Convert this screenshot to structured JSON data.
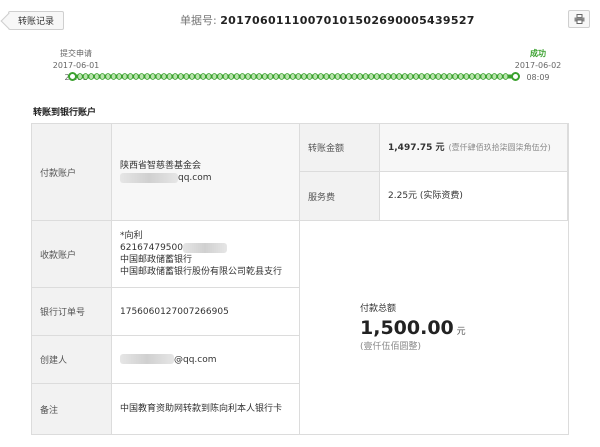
{
  "header": {
    "back_label": "转账记录",
    "order_label": "单据号:",
    "order_number": "20170601110070101502690005439527",
    "print_icon": "printer-icon"
  },
  "progress": {
    "start_label": "提交申请",
    "start_time": "2017-06-01 20:51",
    "end_label": "成功",
    "end_time": "2017-06-02 08:09",
    "color": "#3aa12e"
  },
  "section": {
    "title": "转账到银行账户"
  },
  "payer": {
    "label": "付款账户",
    "name": "陕西省智慈善基金会",
    "email_suffix": "qq.com"
  },
  "transfer_amount": {
    "label": "转账金额",
    "value": "1,497.75 元",
    "note": "(壹仟肆佰玖拾柒圆柒角伍分)"
  },
  "fee": {
    "label": "服务费",
    "value": "2.25元 (实际资费)"
  },
  "payee": {
    "label": "收款账户",
    "name": "*向利",
    "card_prefix": "62167479500",
    "bank": "中国邮政储蓄银行",
    "branch": "中国邮政储蓄银行股份有限公司乾县支行"
  },
  "bank_order": {
    "label": "银行订单号",
    "value": "1756060127007266905"
  },
  "creator": {
    "label": "创建人",
    "email_suffix": "@qq.com"
  },
  "remark": {
    "label": "备注",
    "value": "中国教育资助网转款到陈向利本人银行卡"
  },
  "total": {
    "label": "付款总额",
    "value": "1,500.00",
    "unit": "元",
    "note": "(壹仟伍佰圆整)"
  }
}
